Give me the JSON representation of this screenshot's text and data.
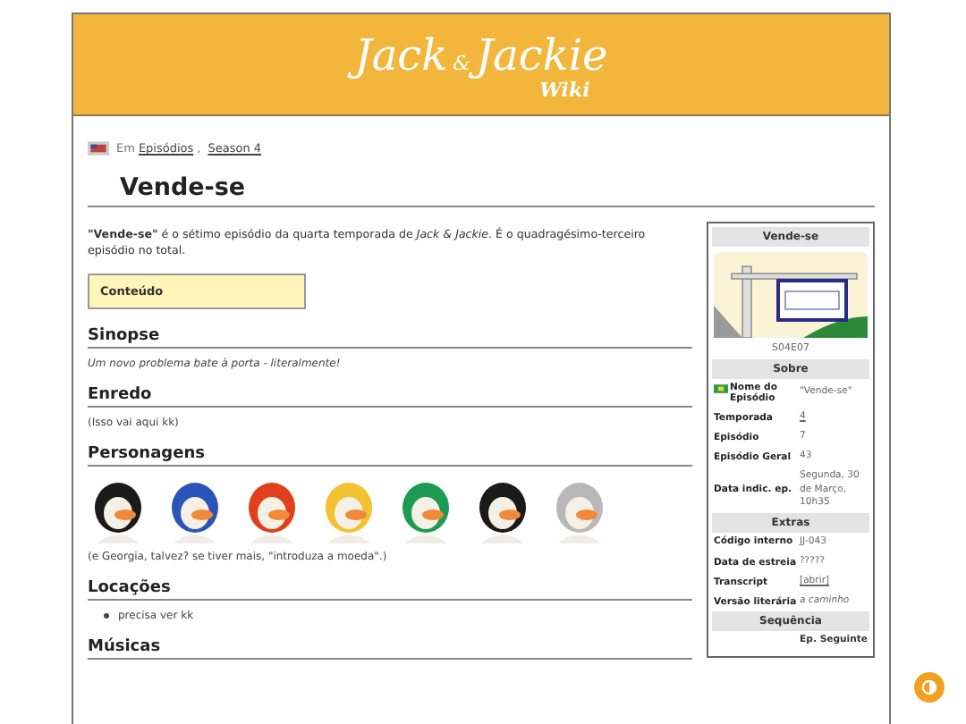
{
  "header": {
    "logo_main": "Jack",
    "logo_amp": "&",
    "logo_second": "Jackie",
    "logo_sub": "Wiki"
  },
  "breadcrumb": {
    "prefix": "Em",
    "links": [
      "Episódios",
      "Season 4"
    ],
    "separator": ","
  },
  "title": "Vende-se",
  "intro": "**\"Vende-se\"** é o sétimo episódio da quarta temporada de *Jack & Jackie*. É o quadragésimo-terceiro episódio no total.",
  "toc": {
    "label": "Conteúdo"
  },
  "sections": [
    {
      "heading": "Sinopse",
      "kind": "italic",
      "text": "Um novo problema bate à porta - literalmente!"
    },
    {
      "heading": "Enredo",
      "kind": "text",
      "text": "(Isso vai aqui kk)"
    },
    {
      "heading": "Personagens",
      "kind": "characters",
      "characters": [
        {
          "color": "#1a1a1a"
        },
        {
          "color": "#2a55b8"
        },
        {
          "color": "#e0401c"
        },
        {
          "color": "#f2c230"
        },
        {
          "color": "#1f9a55"
        },
        {
          "color": "#1a1a1a"
        },
        {
          "color": "#b8b8b8"
        }
      ],
      "text": "(e Georgia, talvez? se tiver mais, \"introduza a moeda\".)"
    },
    {
      "heading": "Locações",
      "kind": "list",
      "items": [
        "precisa ver kk"
      ]
    },
    {
      "heading": "Músicas",
      "kind": "text"
    }
  ],
  "infobox": {
    "title": "Vende-se",
    "caption": "S04E07",
    "groups": [
      {
        "heading": "Sobre",
        "rows": [
          {
            "label": "Nome do Episódio",
            "value": "\"Vende-se\"",
            "kind": "flag"
          },
          {
            "label": "Temporada",
            "value": "4",
            "kind": "link"
          },
          {
            "label": "Episódio",
            "value": "7",
            "kind": "text"
          },
          {
            "label": "Episódio Geral",
            "value": "43",
            "kind": "text"
          },
          {
            "label": "Data indic. ep.",
            "value": "Segunda, 30 de Março, 10h35",
            "kind": "text"
          }
        ]
      },
      {
        "heading": "Extras",
        "rows": [
          {
            "label": "Código interno",
            "value": "JJ-043",
            "kind": "text"
          },
          {
            "label": "Data de estreia",
            "value": "?????",
            "kind": "text"
          },
          {
            "label": "Transcript",
            "value": "[abrir]",
            "kind": "link"
          },
          {
            "label": "Versão literária",
            "value": "a caminho",
            "kind": "italic"
          }
        ]
      },
      {
        "heading": "Sequência",
        "rows": [
          {
            "label": "",
            "value": "Ep. Seguinte",
            "kind": "next"
          }
        ]
      }
    ]
  }
}
